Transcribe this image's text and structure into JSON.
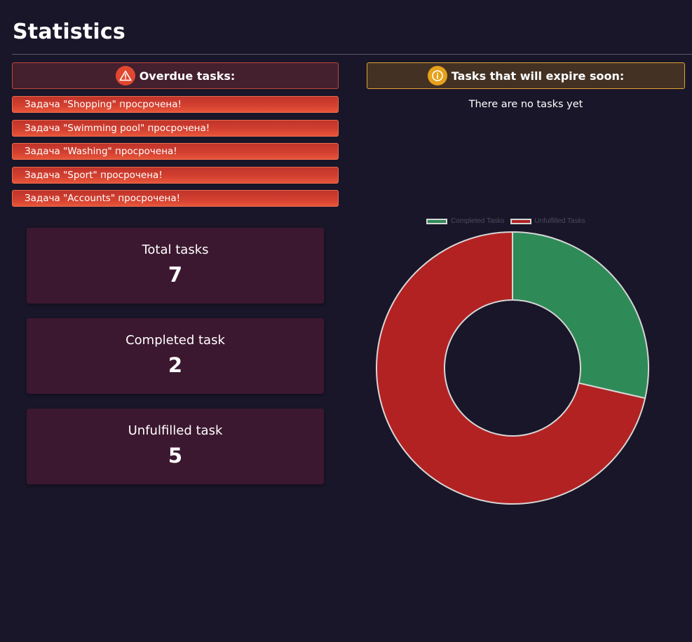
{
  "page": {
    "title": "Statistics"
  },
  "overdue": {
    "header": "Overdue tasks:",
    "icon": "warning-icon",
    "items": [
      "Задача \"Shopping\" просрочена!",
      "Задача \"Swimming pool\" просрочена!",
      "Задача \"Washing\" просрочена!",
      "Задача \"Sport\" просрочена!",
      "Задача \"Accounts\" просрочена!"
    ]
  },
  "expiring": {
    "header": "Tasks that will expire soon:",
    "icon": "info-icon",
    "empty_message": "There are no tasks yet"
  },
  "stats": {
    "total": {
      "label": "Total tasks",
      "value": "7"
    },
    "completed": {
      "label": "Completed task",
      "value": "2"
    },
    "unfulfilled": {
      "label": "Unfulfilled task",
      "value": "5"
    }
  },
  "colors": {
    "background": "#181628",
    "completed": "#2e8b57",
    "unfulfilled": "#b22222",
    "slice_border": "#d6d6d6"
  },
  "chart_data": {
    "type": "pie",
    "donut": true,
    "categories": [
      "Completed Tasks",
      "Unfulfilled Tasks"
    ],
    "values": [
      2,
      5
    ],
    "colors": [
      "#2e8b57",
      "#b22222"
    ],
    "legend_position": "top"
  }
}
